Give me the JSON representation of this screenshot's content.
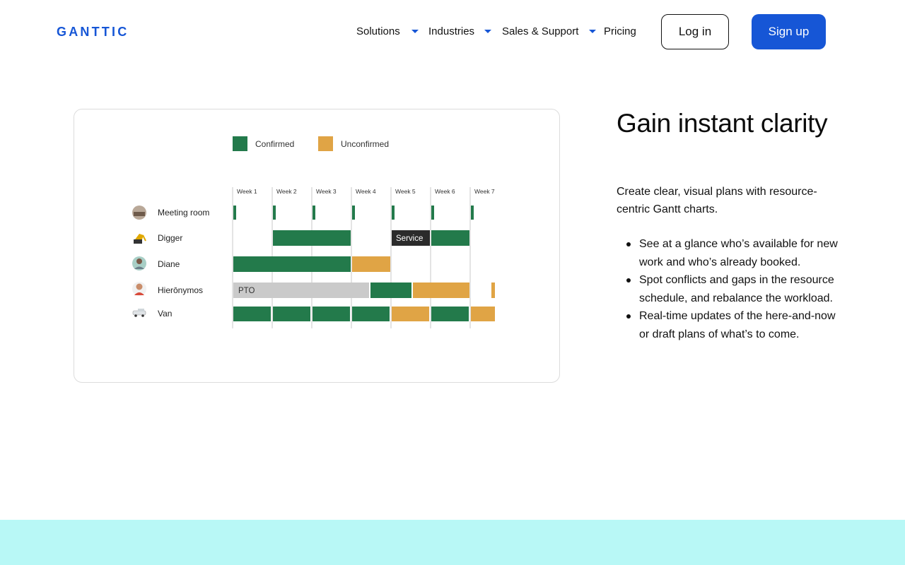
{
  "header": {
    "logo_text": "GANTTIC",
    "nav": [
      {
        "label": "Solutions",
        "has_dropdown": true
      },
      {
        "label": "Industries",
        "has_dropdown": true
      },
      {
        "label": "Sales & Support",
        "has_dropdown": true
      },
      {
        "label": "Pricing",
        "has_dropdown": false
      }
    ],
    "login_label": "Log in",
    "signup_label": "Sign up",
    "accent_color": "#1656d6"
  },
  "gantt": {
    "legend": [
      {
        "label": "Confirmed",
        "color": "#237a4b"
      },
      {
        "label": "Unconfirmed",
        "color": "#e0a445"
      }
    ],
    "weeks": [
      "Week 1",
      "Week 2",
      "Week 3",
      "Week 4",
      "Week 5",
      "Week 6",
      "Week 7"
    ],
    "resources": [
      {
        "name": "Meeting room",
        "icon": "meeting-room-avatar"
      },
      {
        "name": "Digger",
        "icon": "digger-avatar"
      },
      {
        "name": "Diane",
        "icon": "person-avatar"
      },
      {
        "name": "Hierōnymos",
        "icon": "person-avatar"
      },
      {
        "name": "Van",
        "icon": "van-avatar"
      }
    ],
    "bar_labels": {
      "service": "Service",
      "pto": "PTO"
    }
  },
  "content": {
    "headline": "Gain instant clarity",
    "intro": "Create clear, visual plans with resource-centric Gantt charts.",
    "bullets": [
      "See at a glance who’s available for new work and who’s already booked.",
      "Spot conflicts and gaps in the resource schedule, and rebalance the workload.",
      "Real-time updates of the here-and-now or draft plans of what’s to come."
    ]
  },
  "colors": {
    "footer_band": "#b8f8f6"
  }
}
